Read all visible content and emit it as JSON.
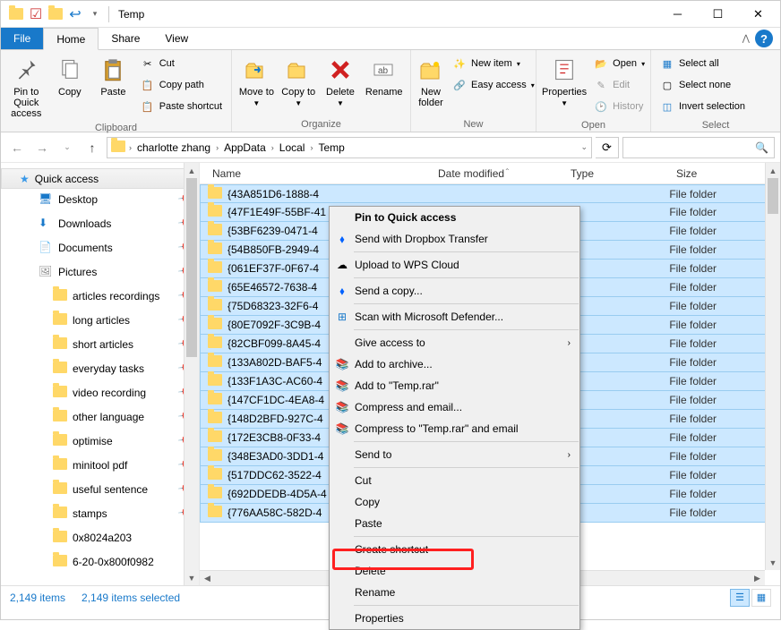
{
  "window": {
    "title": "Temp"
  },
  "tabs": {
    "file": "File",
    "home": "Home",
    "share": "Share",
    "view": "View"
  },
  "ribbon": {
    "clipboard": {
      "label": "Clipboard",
      "pin": "Pin to Quick access",
      "copy": "Copy",
      "paste": "Paste",
      "cut": "Cut",
      "copypath": "Copy path",
      "pasteshortcut": "Paste shortcut"
    },
    "organize": {
      "label": "Organize",
      "moveto": "Move to",
      "copyto": "Copy to",
      "delete": "Delete",
      "rename": "Rename"
    },
    "new": {
      "label": "New",
      "newfolder": "New folder",
      "newitem": "New item",
      "easyaccess": "Easy access"
    },
    "open": {
      "label": "Open",
      "properties": "Properties",
      "open": "Open",
      "edit": "Edit",
      "history": "History"
    },
    "select": {
      "label": "Select",
      "selectall": "Select all",
      "selectnone": "Select none",
      "invert": "Invert selection"
    }
  },
  "address": {
    "crumbs": [
      "charlotte zhang",
      "AppData",
      "Local",
      "Temp"
    ]
  },
  "sidebar": {
    "quick": "Quick access",
    "items": [
      {
        "label": "Desktop",
        "pin": true
      },
      {
        "label": "Downloads",
        "pin": true
      },
      {
        "label": "Documents",
        "pin": true
      },
      {
        "label": "Pictures",
        "pin": true
      },
      {
        "label": "articles recordings",
        "pin": true
      },
      {
        "label": "long articles",
        "pin": true
      },
      {
        "label": "short articles",
        "pin": true
      },
      {
        "label": "everyday tasks",
        "pin": true
      },
      {
        "label": "video recording",
        "pin": true
      },
      {
        "label": "other language",
        "pin": true
      },
      {
        "label": "optimise",
        "pin": true
      },
      {
        "label": "minitool pdf",
        "pin": true
      },
      {
        "label": "useful sentence",
        "pin": true
      },
      {
        "label": "stamps",
        "pin": true
      },
      {
        "label": "0x8024a203",
        "pin": false
      },
      {
        "label": "6-20-0x800f0982",
        "pin": false
      }
    ]
  },
  "columns": {
    "name": "Name",
    "date": "Date modified",
    "type": "Type",
    "size": "Size"
  },
  "filetype": "File folder",
  "files": [
    "{43A851D6-1888-4",
    "{47F1E49F-55BF-41",
    "{53BF6239-0471-4",
    "{54B850FB-2949-4",
    "{061EF37F-0F67-4",
    "{65E46572-7638-4",
    "{75D68323-32F6-4",
    "{80E7092F-3C9B-4",
    "{82CBF099-8A45-4",
    "{133A802D-BAF5-4",
    "{133F1A3C-AC60-4",
    "{147CF1DC-4EA8-4",
    "{148D2BFD-927C-4",
    "{172E3CB8-0F33-4",
    "{348E3AD0-3DD1-4",
    "{517DDC62-3522-4",
    "{692DDEDB-4D5A-4",
    "{776AA58C-582D-4"
  ],
  "status": {
    "items": "2,149 items",
    "selected": "2,149 items selected"
  },
  "ctx": {
    "pin": "Pin to Quick access",
    "dropbox": "Send with Dropbox Transfer",
    "wps": "Upload to WPS Cloud",
    "sendcopy": "Send a copy...",
    "defender": "Scan with Microsoft Defender...",
    "giveaccess": "Give access to",
    "addarchive": "Add to archive...",
    "addtemp": "Add to \"Temp.rar\"",
    "compressemail": "Compress and email...",
    "compresstemp": "Compress to \"Temp.rar\" and email",
    "sendto": "Send to",
    "cut": "Cut",
    "copy": "Copy",
    "paste": "Paste",
    "shortcut": "Create shortcut",
    "delete": "Delete",
    "rename": "Rename",
    "props": "Properties"
  }
}
